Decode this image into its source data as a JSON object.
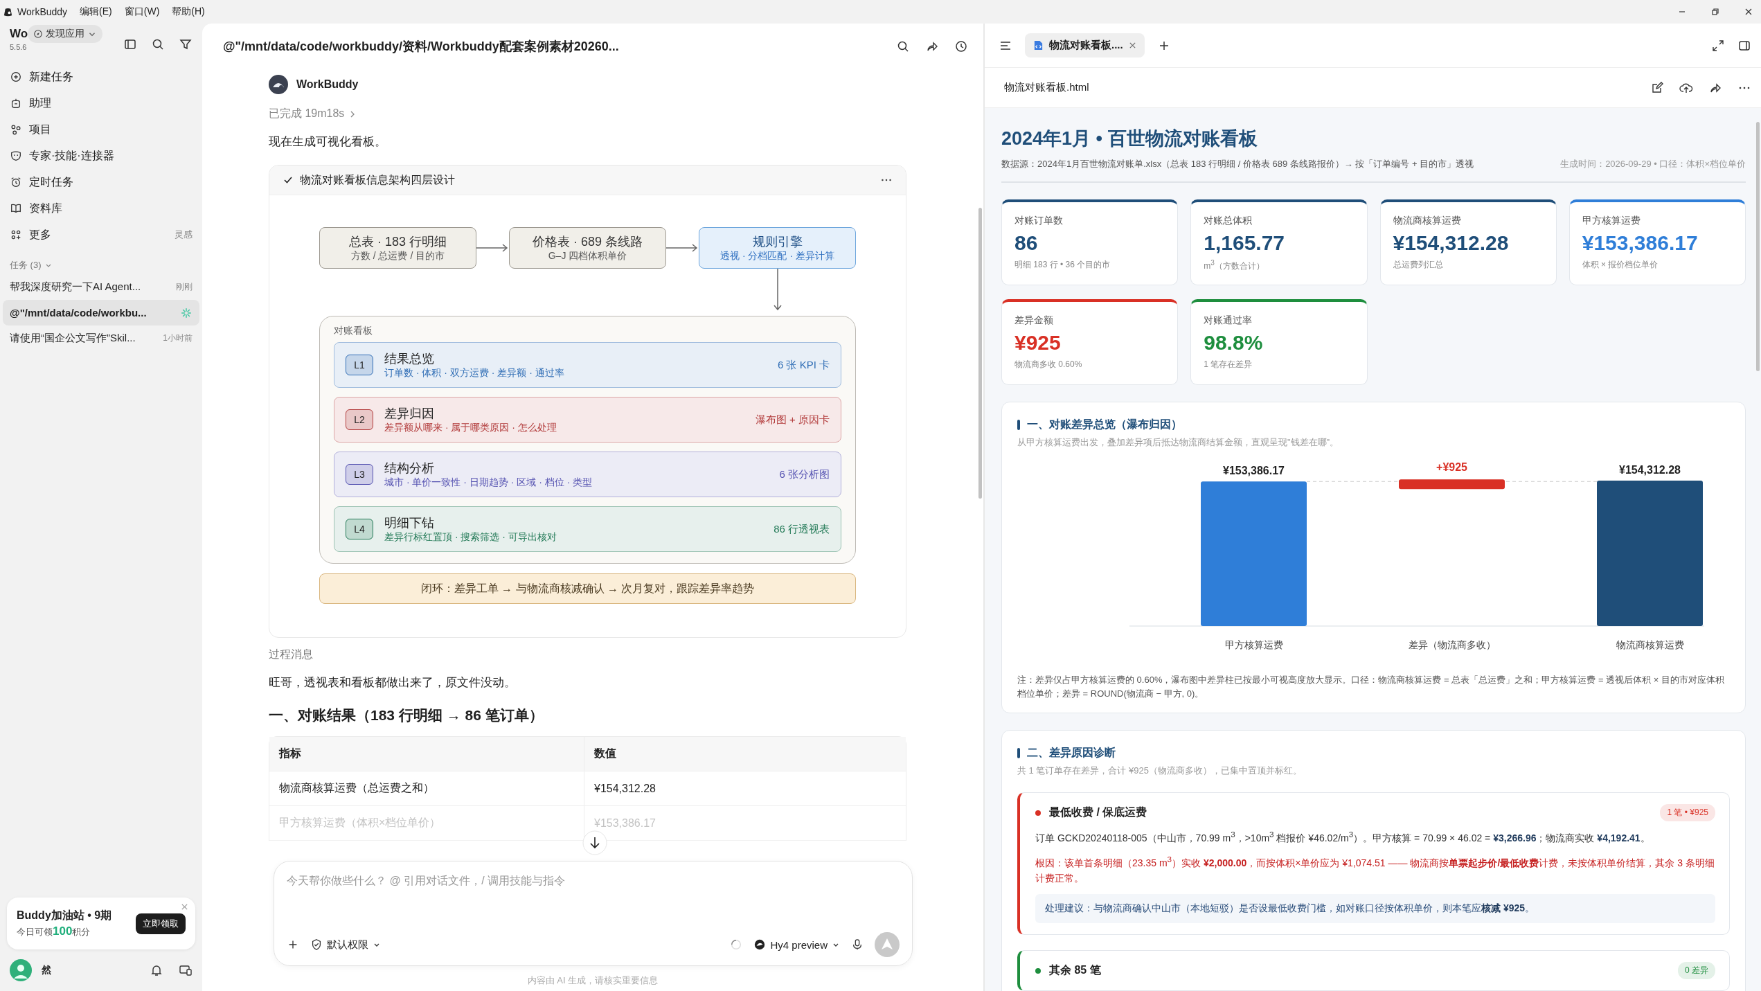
{
  "menu_bar": {
    "app": "WorkBuddy",
    "items": [
      "编辑(E)",
      "窗口(W)",
      "帮助(H)"
    ]
  },
  "sidebar": {
    "title": "Wo",
    "version": "5.5.6",
    "discover_button": "发现应用",
    "nav": [
      {
        "label": "新建任务",
        "kind": "plus"
      },
      {
        "label": "助理",
        "kind": "assistant"
      },
      {
        "label": "项目",
        "kind": "project"
      },
      {
        "label": "专家·技能·连接器",
        "kind": "expert"
      },
      {
        "label": "定时任务",
        "kind": "alarm"
      },
      {
        "label": "资料库",
        "kind": "book"
      },
      {
        "label": "更多",
        "kind": "more",
        "hint": "灵感"
      }
    ],
    "tasks_header": "任务 (3)",
    "tasks": [
      {
        "title": "帮我深度研究一下AI Agent...",
        "time": "刚刚",
        "selected": false,
        "running": false
      },
      {
        "title": "@\"/mnt/data/code/workbu...",
        "selected": true,
        "running": true
      },
      {
        "title": "请使用“国企公文写作”Skil...",
        "time": "1小时前",
        "selected": false,
        "running": false
      }
    ],
    "promo": {
      "title": "Buddy加油站 • 9期",
      "text": "今日可领**100**积分",
      "button": "立即领取"
    },
    "user": {
      "name": "然"
    }
  },
  "chat": {
    "title": "@\"/mnt/data/code/workbuddy/资料/Workbuddy配套案例素材20260...",
    "assistant": "WorkBuddy",
    "status": "已完成 19m18s",
    "intro": "现在生成可视化看板。",
    "card": {
      "title": "物流对账看板信息架构四层设计",
      "done": true,
      "flow": [
        {
          "title": "总表 · 183 行明细",
          "subtitle": "方数 / 总运费 / 目的市",
          "highlighted": false
        },
        {
          "title": "价格表 · 689 条线路",
          "subtitle": "G–J 四档体积单价",
          "highlighted": false
        },
        {
          "title": "规则引擎",
          "subtitle": "透视 · 分档匹配 · 差异计算",
          "highlighted": true
        }
      ],
      "board_label": "对账看板",
      "layers": [
        {
          "code": "L1",
          "title": "结果总览",
          "desc": "订单数 · 体积 · 双方运费 · 差异额 · 通过率",
          "tag": "6 张 KPI 卡",
          "color": "#2f6db5"
        },
        {
          "code": "L2",
          "title": "差异归因",
          "desc": "差异额从哪来 · 属于哪类原因 · 怎么处理",
          "tag": "瀑布图 + 原因卡",
          "color": "#b23b3b"
        },
        {
          "code": "L3",
          "title": "结构分析",
          "desc": "城市 · 单价一致性 · 日期趋势 · 区域 · 档位 · 类型",
          "tag": "6 张分析图",
          "color": "#5350b0"
        },
        {
          "code": "L4",
          "title": "明细下钻",
          "desc": "差异行标红置顶 · 搜索筛选 · 可导出核对",
          "tag": "86 行透视表",
          "color": "#237a57"
        }
      ],
      "loop": "闭环：差异工单 → 与物流商核减确认 → 次月复对，跟踪差异率趋势"
    },
    "process_label": "过程消息",
    "reply": "旺哥，透视表和看板都做出来了，原文件没动。",
    "heading": "一、对账结果（183 行明细 → 86 笔订单）",
    "table": {
      "columns": [
        "指标",
        "数值"
      ],
      "rows": [
        {
          "cells": [
            "物流商核算运费（总运费之和）",
            "¥154,312.28"
          ],
          "faded": false
        },
        {
          "cells": [
            "甲方核算运费（体积×档位单价）",
            "¥153,386.17"
          ],
          "faded": true
        }
      ]
    },
    "composer": {
      "placeholder": "今天帮你做些什么？ @ 引用对话文件，/ 调用技能与指令",
      "permission": "默认权限",
      "model": "Hy4 preview"
    },
    "disclaimer": "内容由 AI 生成，请核实重要信息"
  },
  "viewer": {
    "tab": {
      "title": "物流对账看板....",
      "selected": true
    },
    "file": "物流对账看板.html",
    "report": {
      "title": "2024年1月 • 百世物流对账看板",
      "source": "数据源：2024年1月百世物流对账单.xlsx（总表 183 行明细 / 价格表 689 条线路报价）→ 按「订单编号 + 目的市」透视",
      "meta": "生成时间：2026-09-29 • 口径：体积×档位单价",
      "kpis": [
        {
          "label": "对账订单数",
          "value": "86",
          "note": "明细 183 行 • 36 个目的市",
          "color": "#1f4e79"
        },
        {
          "label": "对账总体积",
          "value": "1,165.77",
          "note": "m$^{3}$（方数合计）",
          "color": "#1f4e79"
        },
        {
          "label": "物流商核算运费",
          "value": "¥154,312.28",
          "note": "总运费列汇总",
          "color": "#1f4e79"
        },
        {
          "label": "甲方核算运费",
          "value": "¥153,386.17",
          "note": "体积 × 报价档位单价",
          "color": "#2f7ed8"
        },
        {
          "label": "差异金额",
          "value": "¥925",
          "note": "物流商多收 0.60%",
          "color": "#d93025"
        },
        {
          "label": "对账通过率",
          "value": "98.8%",
          "note": "1 笔存在差异",
          "color": "#1e8e3e"
        }
      ],
      "waterfall": {
        "title": "一、对账差异总览（瀑布归因）",
        "subtitle": "从甲方核算运费出发，叠加差异项后抵达物流商结算金额，直观呈现\"钱差在哪\"。",
        "chart_data": {
          "type": "bar",
          "categories": [
            "甲方核算运费",
            "差异（物流商多收）",
            "物流商核算运费"
          ],
          "values": [
            153386.17,
            null,
            154312.28
          ],
          "value_labels": [
            "¥153,386.17",
            null,
            "¥154,312.28"
          ],
          "colors": [
            "#2f7ed8",
            "#d93025",
            "#1f4e79"
          ],
          "annotations": [
            "+¥925"
          ]
        },
        "note": "注：差异仅占甲方核算运费的 0.60%，瀑布图中差异柱已按最小可视高度放大显示。口径：物流商核算运费 = 总表「总运费」之和；甲方核算运费 = 透视后体积 × 目的市对应体积档位单价；差异 = ROUND(物流商 − 甲方, 0)。"
      },
      "diagnosis": {
        "title": "二、差异原因诊断",
        "subtitle": "共 1 笔订单存在差异，合计 ¥925（物流商多收），已集中置顶并标红。",
        "groups": [
          {
            "title": "最低收费 / 保底运费",
            "badge": "1 笔 • ¥925",
            "color": "#d93025",
            "detail": "订单 GCKD20240118-005（中山市，70.99 m$^{3}$，>10m$^{3}$ 档报价 ¥46.02/m$^{3}$）。甲方核算 = 70.99 × 46.02 = **¥3,266.96**；物流商实收 **¥4,192.41**。",
            "cause": "根因：该单首条明细（23.35 m$^{3}$）实收 **¥2,000.00**，而按体积×单价应为 ¥1,074.51 —— 物流商按**单票起步价/最低收费**计费，未按体积单价结算，其余 3 条明细计费正常。",
            "advice": "处理建议：与物流商确认中山市（本地短驳）是否设最低收费门槛，如对账口径按体积单价，则本笔应**核减 ¥925**。"
          },
          {
            "title": "其余 85 笔",
            "badge": "0 差异",
            "color": "#1e8e3e"
          }
        ]
      }
    }
  }
}
